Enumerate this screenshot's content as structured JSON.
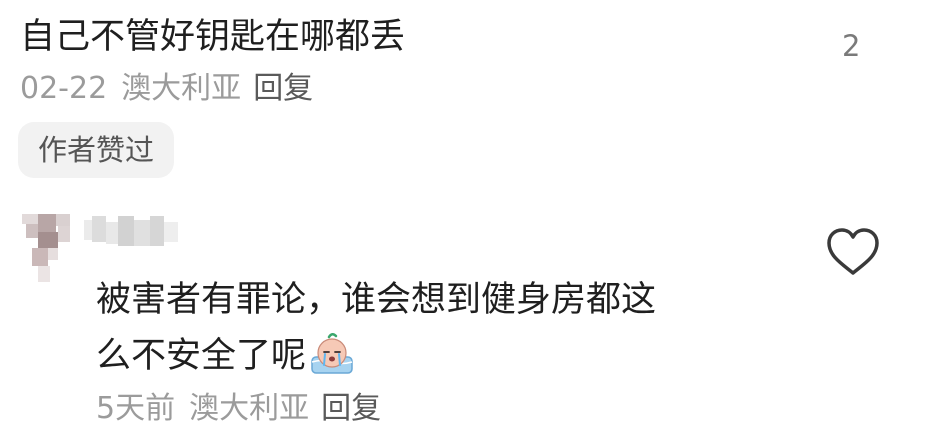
{
  "comment_1": {
    "text": "自己不管好钥匙在哪都丢",
    "date": "02-22",
    "location": "澳大利亚",
    "reply_label": "回复",
    "author_liked_label": "作者赞过",
    "like_count": "2"
  },
  "comment_2": {
    "text_line_1": "被害者有罪论，谁会想到健身房都这",
    "text_line_2": "么不安全了呢",
    "time": "5天前",
    "location": "澳大利亚",
    "reply_label": "回复"
  },
  "icons": {
    "like": "heart-outline-icon",
    "emoji": "crying-face-emoji-icon"
  },
  "colors": {
    "text_primary": "#1f1f1f",
    "text_meta": "#9b9b9b",
    "reply": "#5a5a5a",
    "chip_bg": "#f2f2f2"
  }
}
